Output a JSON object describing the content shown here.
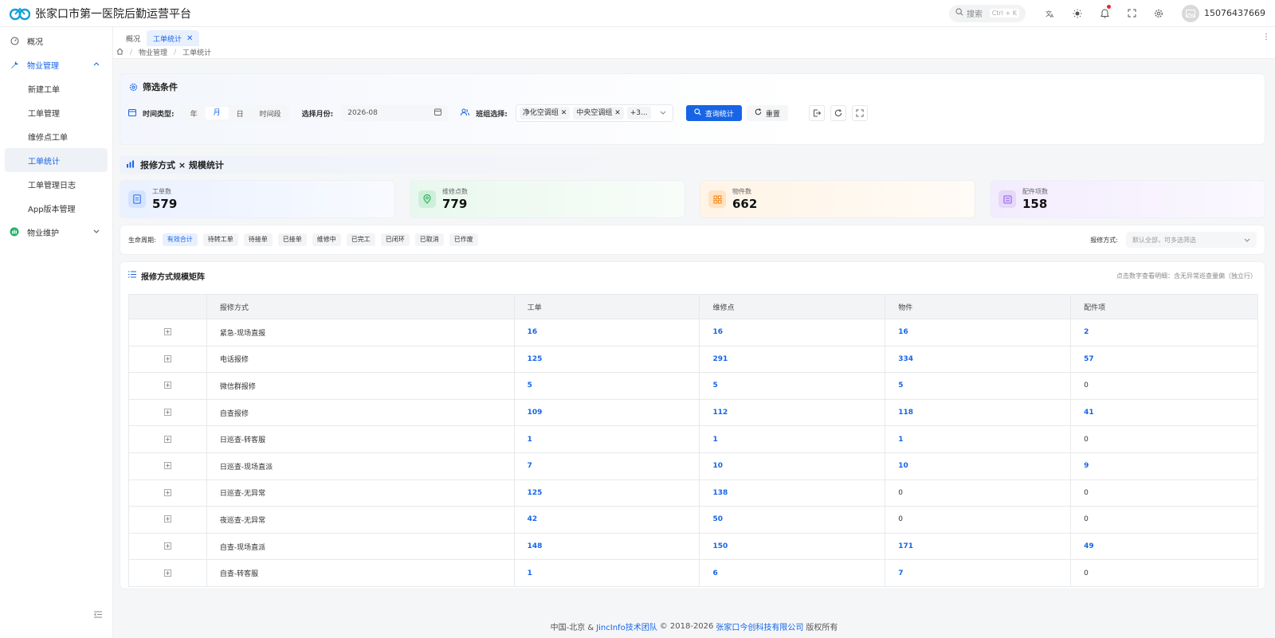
{
  "header": {
    "title": "张家口市第一医院后勤运营平台",
    "search_label": "搜索",
    "search_shortcut": "Ctrl + K",
    "username": "15076437669"
  },
  "sidebar": {
    "items": [
      {
        "label": "概况"
      },
      {
        "label": "物业管理"
      },
      {
        "label": "新建工单"
      },
      {
        "label": "工单管理"
      },
      {
        "label": "维修点工单"
      },
      {
        "label": "工单统计"
      },
      {
        "label": "工单管理日志"
      },
      {
        "label": "App版本管理"
      },
      {
        "label": "物业维护"
      }
    ]
  },
  "tabs": [
    {
      "label": "概况"
    },
    {
      "label": "工单统计"
    }
  ],
  "breadcrumb": [
    "物业管理",
    "工单统计"
  ],
  "filter": {
    "title": "筛选条件",
    "time_type_label": "时间类型:",
    "time_options": [
      "年",
      "月",
      "日",
      "时间段"
    ],
    "month_label": "选择月份:",
    "month_value": "2026-08",
    "team_label": "班组选择:",
    "team_tags": [
      "净化空调组",
      "中央空调组",
      "+3..."
    ],
    "query_button": "查询统计",
    "reset_button": "重置"
  },
  "section": {
    "title": "报修方式 × 规模统计"
  },
  "stats": [
    {
      "label": "工单数",
      "value": "579",
      "color": "#3d7bf0"
    },
    {
      "label": "维修点数",
      "value": "779",
      "color": "#2fb35a"
    },
    {
      "label": "物件数",
      "value": "662",
      "color": "#f08a24"
    },
    {
      "label": "配件项数",
      "value": "158",
      "color": "#8e5ce6"
    }
  ],
  "lifecycle": {
    "label": "生命周期:",
    "chips": [
      "有效合计",
      "待转工单",
      "待接单",
      "已接单",
      "维修中",
      "已完工",
      "已闭环",
      "已取消",
      "已作废"
    ],
    "method_label": "报修方式:",
    "method_placeholder": "默认全部，可多选筛选"
  },
  "matrix": {
    "title": "报修方式规模矩阵",
    "hint": "点击数字查看明细：含无异常巡查量偏（独立行）",
    "columns": [
      "报修方式",
      "工单",
      "维修点",
      "物件",
      "配件项"
    ],
    "rows": [
      {
        "method": "紧急-现场直报",
        "orders": "16",
        "points": "16",
        "items": "16",
        "parts": "2"
      },
      {
        "method": "电话报修",
        "orders": "125",
        "points": "291",
        "items": "334",
        "parts": "57"
      },
      {
        "method": "微信群报修",
        "orders": "5",
        "points": "5",
        "items": "5",
        "parts": "0"
      },
      {
        "method": "自查报修",
        "orders": "109",
        "points": "112",
        "items": "118",
        "parts": "41"
      },
      {
        "method": "日巡查-转客服",
        "orders": "1",
        "points": "1",
        "items": "1",
        "parts": "0"
      },
      {
        "method": "日巡查-现场直派",
        "orders": "7",
        "points": "10",
        "items": "10",
        "parts": "9"
      },
      {
        "method": "日巡查-无异常",
        "orders": "125",
        "points": "138",
        "items": "0",
        "parts": "0"
      },
      {
        "method": "夜巡查-无异常",
        "orders": "42",
        "points": "50",
        "items": "0",
        "parts": "0"
      },
      {
        "method": "自查-现场直派",
        "orders": "148",
        "points": "150",
        "items": "171",
        "parts": "49"
      },
      {
        "method": "自查-转客服",
        "orders": "1",
        "points": "6",
        "items": "7",
        "parts": "0"
      }
    ]
  },
  "footer": {
    "prefix": "中国-北京 &",
    "team_link": "JincInfo技术团队",
    "copyright": "© 2018-2026",
    "company_link": "张家口今创科技有限公司",
    "suffix": "版权所有"
  },
  "colors": {
    "primary": "#1765e6",
    "logo": "#12a0d8"
  }
}
